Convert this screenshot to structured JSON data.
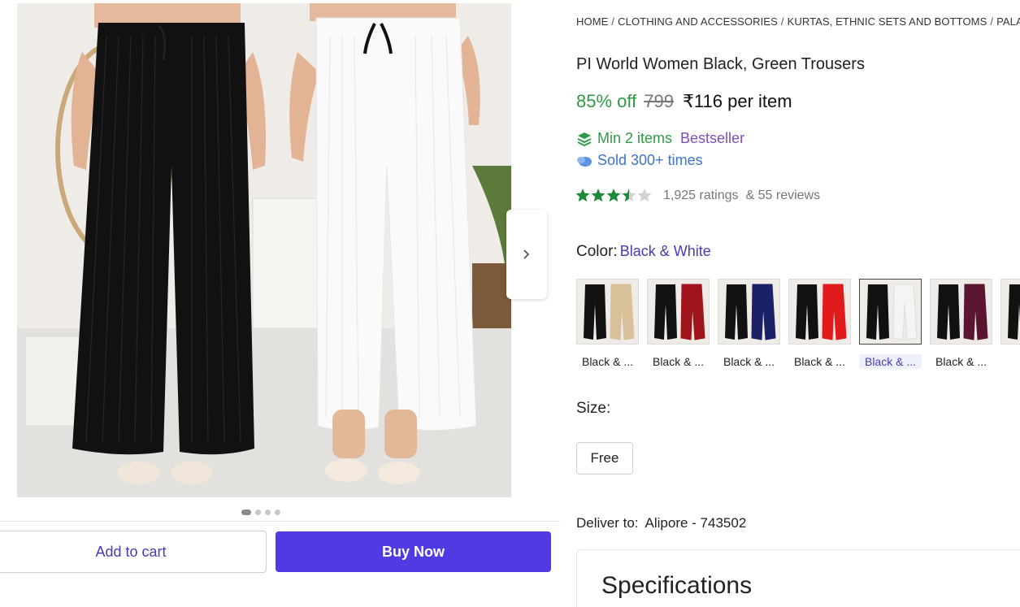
{
  "gallery": {
    "image_alt": "Two women wearing black and white palazzo trousers",
    "slide_count": 4,
    "active_slide": 1
  },
  "actions": {
    "add_to_cart_label": "Add to cart",
    "buy_now_label": "Buy Now"
  },
  "breadcrumb": [
    "HOME",
    "CLOTHING AND ACCESSORIES",
    "KURTAS, ETHNIC SETS AND BOTTOMS",
    "PALAZZOS"
  ],
  "product": {
    "title": "PI World Women Black, Green Trousers",
    "discount": "85% off",
    "mrp": "799",
    "price": "₹116 per item",
    "min_items": "Min 2 items",
    "bestseller": "Bestseller",
    "sold": "Sold 300+ times",
    "rating_value": 3.5,
    "ratings_count": "1,925 ratings",
    "reviews_count": "& 55 reviews"
  },
  "color": {
    "label": "Color:",
    "selected_value": "Black & White",
    "variants": [
      {
        "label": "Black & ...",
        "second_color": "#d8c09a",
        "selected": false
      },
      {
        "label": "Black & ...",
        "second_color": "#a0141e",
        "selected": false
      },
      {
        "label": "Black & ...",
        "second_color": "#1b2166",
        "selected": false
      },
      {
        "label": "Black & ...",
        "second_color": "#e11b1b",
        "selected": false
      },
      {
        "label": "Black & ...",
        "second_color": "#f4f4f4",
        "selected": true
      },
      {
        "label": "Black & ...",
        "second_color": "#5a1631",
        "selected": false
      },
      {
        "label": "Bla",
        "second_color": "#1a1a1a",
        "selected": false
      }
    ]
  },
  "size": {
    "label": "Size:",
    "options": [
      "Free"
    ]
  },
  "delivery": {
    "label": "Deliver to:",
    "location": "Alipore - 743502"
  },
  "specs": {
    "title": "Specifications"
  },
  "colors": {
    "accent": "#4f3ae4",
    "discount_green": "#2f9a45",
    "star_green": "#1f8a3b",
    "bestseller_purple": "#7b4fb8",
    "sold_blue": "#3f74c9"
  }
}
